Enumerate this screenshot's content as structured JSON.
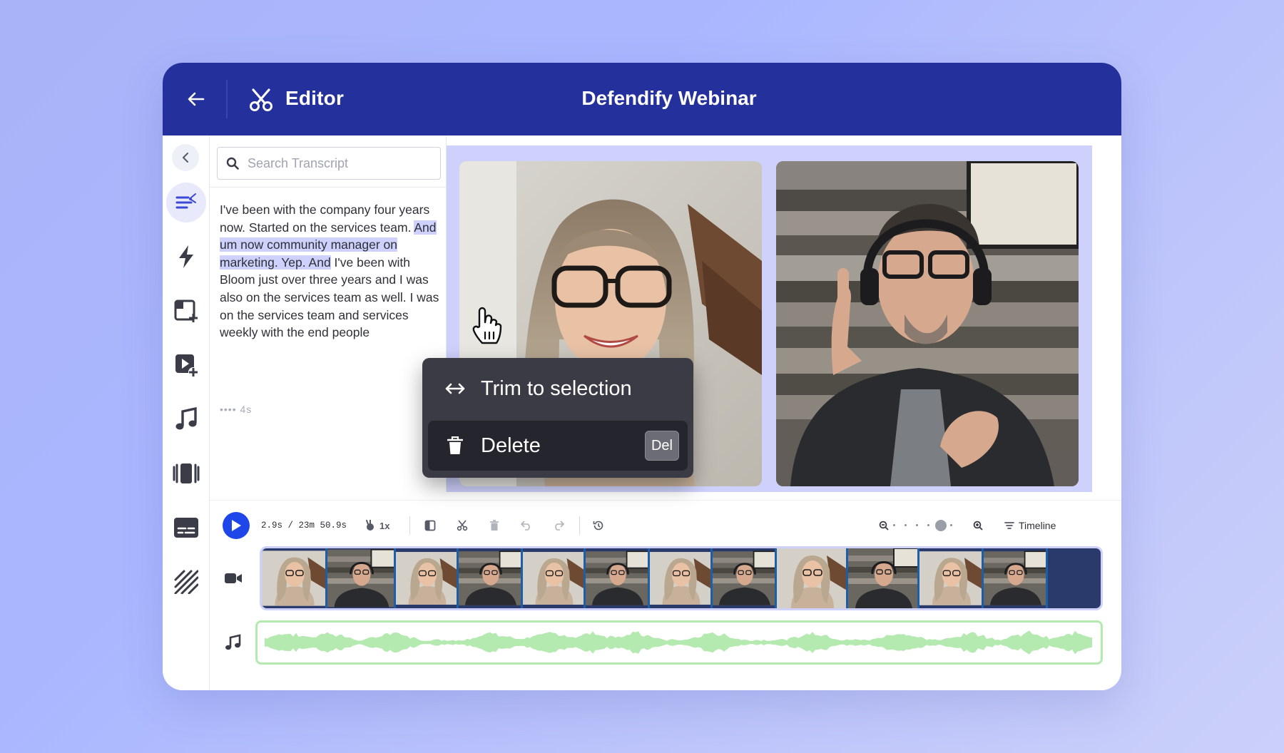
{
  "header": {
    "app_title": "Editor",
    "doc_title": "Defendify Webinar"
  },
  "rail": {
    "items": [
      {
        "name": "transcript-edit-icon",
        "active": true
      },
      {
        "name": "lightning-icon",
        "active": false
      },
      {
        "name": "add-layout-icon",
        "active": false
      },
      {
        "name": "add-media-icon",
        "active": false
      },
      {
        "name": "music-icon",
        "active": false
      },
      {
        "name": "aspect-ratio-icon",
        "active": false
      },
      {
        "name": "captions-icon",
        "active": false
      },
      {
        "name": "background-pattern-icon",
        "active": false
      }
    ]
  },
  "transcript": {
    "search_placeholder": "Search Transcript",
    "segments": {
      "before": "I've been with the company four years now. Started on the services team. ",
      "selected": "And um now community manager on marketing. Yep. And",
      "after": " I've been with Bloom just over three years and I was also on the services team as well. I was on the services team and services weekly with the end people"
    },
    "meta": "•••• 4s"
  },
  "context_menu": {
    "trim_label": "Trim to selection",
    "delete_label": "Delete",
    "delete_shortcut": "Del"
  },
  "controls": {
    "time_readout": "2.9s / 23m 50.9s",
    "speed_label": "1x",
    "timeline_label": "Timeline",
    "zoom_level": 0.7
  },
  "colors": {
    "header": "#24309b",
    "accent": "#1f46e8",
    "selection": "#cdd1fb",
    "audio_wave": "#b4eab0"
  }
}
